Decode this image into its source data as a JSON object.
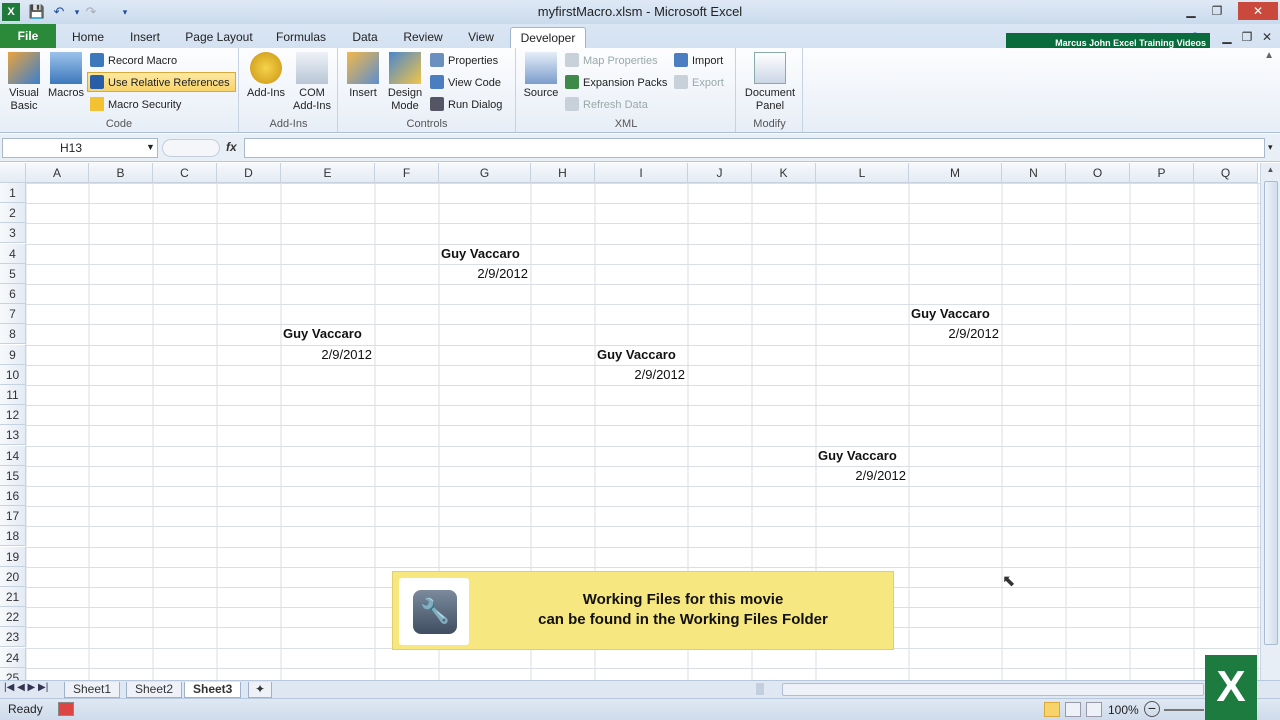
{
  "window": {
    "title": "myfirstMacro.xlsm - Microsoft Excel"
  },
  "tabs": {
    "file": "File",
    "home": "Home",
    "insert": "Insert",
    "page_layout": "Page Layout",
    "formulas": "Formulas",
    "data": "Data",
    "review": "Review",
    "view": "View",
    "developer": "Developer"
  },
  "banner": "Marcus John Excel Training Videos",
  "ribbon": {
    "code": {
      "label": "Code",
      "visual_basic": "Visual Basic",
      "macros": "Macros",
      "record_macro": "Record Macro",
      "use_relative_references": "Use Relative References",
      "macro_security": "Macro Security"
    },
    "addins": {
      "label": "Add-Ins",
      "add_ins": "Add-Ins",
      "com_add_ins": "COM Add-Ins"
    },
    "controls": {
      "label": "Controls",
      "insert": "Insert",
      "design_mode": "Design Mode",
      "properties": "Properties",
      "view_code": "View Code",
      "run_dialog": "Run Dialog"
    },
    "xml": {
      "label": "XML",
      "source": "Source",
      "map_properties": "Map Properties",
      "expansion_packs": "Expansion Packs",
      "refresh_data": "Refresh Data",
      "import": "Import",
      "export": "Export"
    },
    "modify": {
      "label": "Modify",
      "document_panel": "Document Panel"
    }
  },
  "formula_bar": {
    "name_box": "H13",
    "fx": "fx",
    "value": ""
  },
  "columns": [
    "A",
    "B",
    "C",
    "D",
    "E",
    "F",
    "G",
    "H",
    "I",
    "J",
    "K",
    "L",
    "M",
    "N",
    "O",
    "P",
    "Q"
  ],
  "rows": [
    "1",
    "2",
    "3",
    "4",
    "5",
    "6",
    "7",
    "8",
    "9",
    "10",
    "11",
    "12",
    "13",
    "14",
    "15",
    "16",
    "17",
    "18",
    "19",
    "20",
    "21",
    "22",
    "23",
    "24",
    "25"
  ],
  "cells": [
    {
      "ref": "G4",
      "text": "Guy Vaccaro",
      "bold": true
    },
    {
      "ref": "G5",
      "text": "2/9/2012",
      "bold": false
    },
    {
      "ref": "E8",
      "text": "Guy Vaccaro",
      "bold": true
    },
    {
      "ref": "E9",
      "text": "2/9/2012",
      "bold": false
    },
    {
      "ref": "I9",
      "text": "Guy Vaccaro",
      "bold": true
    },
    {
      "ref": "I10",
      "text": "2/9/2012",
      "bold": false
    },
    {
      "ref": "M7",
      "text": "Guy Vaccaro",
      "bold": true
    },
    {
      "ref": "M8",
      "text": "2/9/2012",
      "bold": false
    },
    {
      "ref": "L14",
      "text": "Guy Vaccaro",
      "bold": true
    },
    {
      "ref": "L15",
      "text": "2/9/2012",
      "bold": false
    }
  ],
  "sheets": [
    "Sheet1",
    "Sheet2",
    "Sheet3"
  ],
  "active_sheet": "Sheet3",
  "status": {
    "ready": "Ready",
    "zoom": "100%"
  },
  "notice": {
    "line1": "Working Files for this movie",
    "line2": "can be found in the Working Files Folder"
  },
  "colors": {
    "file_tab": "#2a8a3a",
    "highlight": "#f8d36a",
    "notice_bg": "#f7e781"
  }
}
